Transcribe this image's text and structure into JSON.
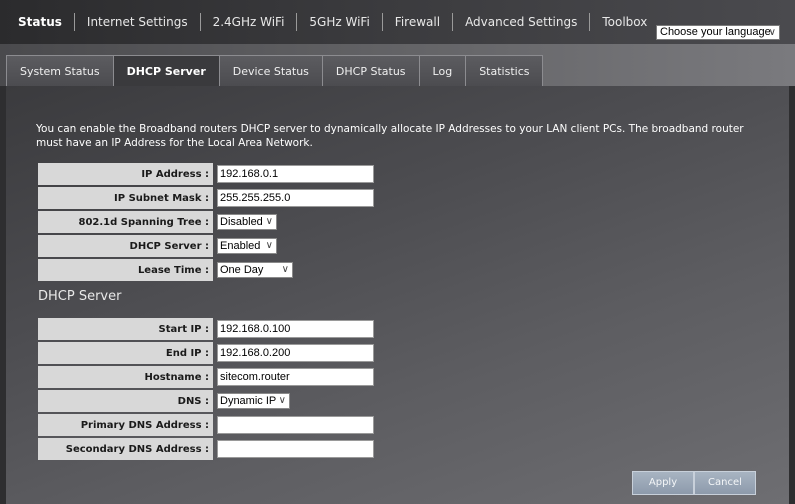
{
  "topnav": {
    "items": [
      "Status",
      "Internet Settings",
      "2.4GHz WiFi",
      "5GHz WiFi",
      "Firewall",
      "Advanced Settings",
      "Toolbox"
    ],
    "active": 0
  },
  "language": {
    "selected": "Choose your language"
  },
  "subtabs": {
    "items": [
      "System Status",
      "DHCP Server",
      "Device Status",
      "DHCP Status",
      "Log",
      "Statistics"
    ],
    "active": 1
  },
  "intro": "You can enable the Broadband routers DHCP server to dynamically allocate IP Addresses to your LAN client PCs. The broadband router must have an IP Address for the Local Area Network.",
  "lan": {
    "ip_label": "IP Address :",
    "ip_value": "192.168.0.1",
    "mask_label": "IP Subnet Mask :",
    "mask_value": "255.255.255.0",
    "stp_label": "802.1d Spanning Tree :",
    "stp_value": "Disabled",
    "dhcp_label": "DHCP Server :",
    "dhcp_value": "Enabled",
    "lease_label": "Lease Time :",
    "lease_value": "One Day"
  },
  "dhcp": {
    "section_title": "DHCP Server",
    "start_label": "Start IP :",
    "start_value": "192.168.0.100",
    "end_label": "End IP :",
    "end_value": "192.168.0.200",
    "host_label": "Hostname :",
    "host_value": "sitecom.router",
    "dns_label": "DNS :",
    "dns_value": "Dynamic IP",
    "pdns_label": "Primary DNS Address :",
    "pdns_value": "",
    "sdns_label": "Secondary DNS Address :",
    "sdns_value": ""
  },
  "buttons": {
    "apply": "Apply",
    "cancel": "Cancel"
  }
}
